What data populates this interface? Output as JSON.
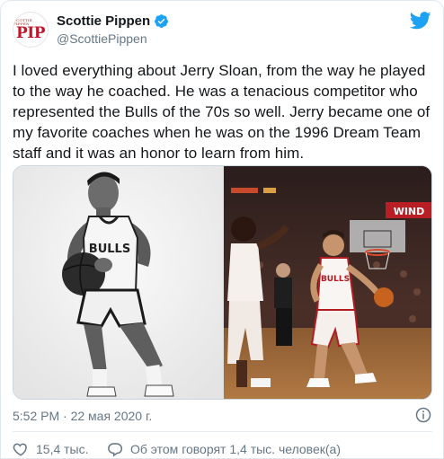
{
  "author": {
    "name": "Scottie Pippen",
    "handle": "@ScottiePippen",
    "avatar_text": "PIP",
    "avatar_subtext": "SCOTTIE PIPPEN",
    "verified": true
  },
  "tweet": {
    "text": "I loved everything about Jerry Sloan, from the way he played to the way he coached. He was a tenacious competitor who represented the Bulls of the 70s so well. Jerry became one of my favorite coaches when he was on the 1996 Dream Team staff and it was an honor to learn from him.",
    "timestamp": "5:52 PM · 22 мая 2020 г."
  },
  "media": {
    "left_jersey": "BULLS",
    "right_jersey": "BULLS",
    "right_banner": "WIND"
  },
  "stats": {
    "likes": "15,4 тыс.",
    "comments": "Об этом говорят 1,4 тыс. человек(а)"
  },
  "colors": {
    "brand_blue": "#1da1f2",
    "avatar_red": "#c2172b",
    "muted": "#657786"
  },
  "icons": [
    "verified-badge-icon",
    "twitter-bird-icon",
    "info-icon",
    "heart-icon",
    "comment-icon"
  ]
}
